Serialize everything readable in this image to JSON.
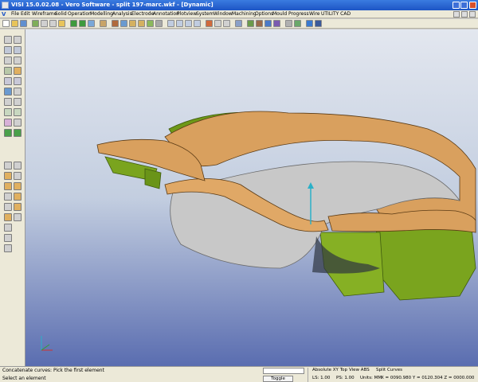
{
  "window": {
    "title": "VISI 15.0.02.08 - Vero Software - split 197-marc.wkf - [Dynamic]"
  },
  "menu": {
    "logo": "V",
    "items": [
      "File",
      "Edit",
      "Wireframe",
      "Solid",
      "Operation",
      "Modelling",
      "Analysis",
      "Electrode",
      "Annotation",
      "Plotview",
      "System",
      "Window",
      "Machining",
      "Options",
      "Mould",
      "Progress",
      "Wire",
      "UTILITY CAD"
    ]
  },
  "status": {
    "line1": "Concatenate curves: Pick the first element",
    "line2": "Select an element",
    "toggle_label": "Toggle",
    "layer": "LS: 1.00",
    "ps": "PS: 1.00",
    "units": "Units: MM",
    "view_label": "Absolute XY Top",
    "view_abs": "View ABS",
    "split_curves": "Split Curves",
    "coords": "X = 0090.980 Y = 0120.304 Z = 0000.000"
  },
  "colors": {
    "title_blue": "#1d55c5",
    "toolbar_bg": "#ece9d8",
    "part_orange": "#d9a05e",
    "part_green": "#7aa41e",
    "part_grey": "#c8c8c8"
  },
  "icons": {
    "axis_triad": "xyz-axis-icon"
  }
}
